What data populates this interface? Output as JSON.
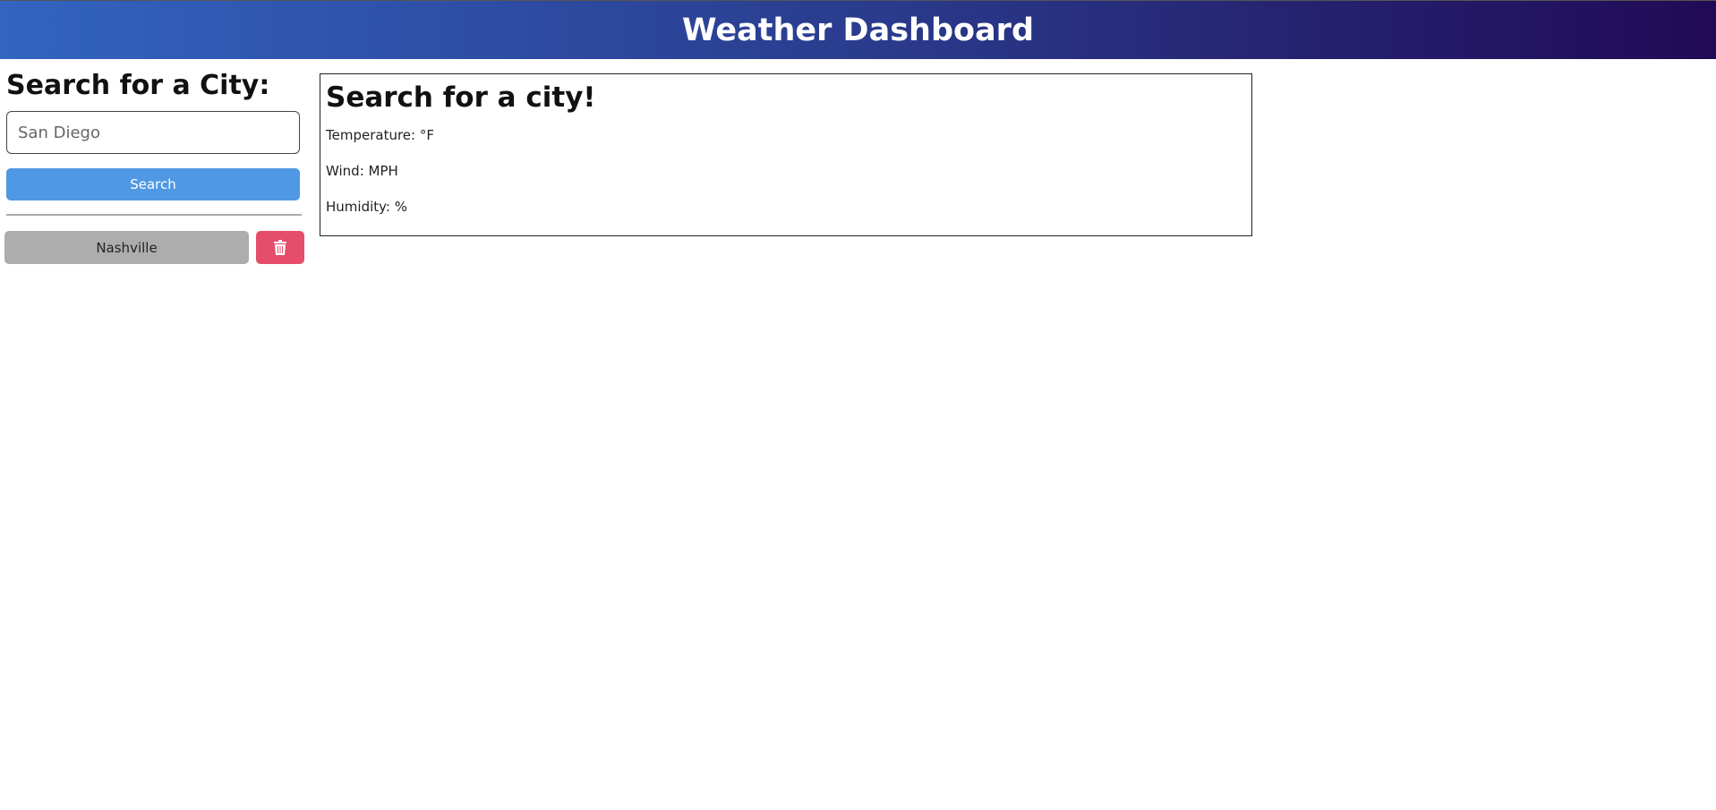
{
  "header": {
    "title": "Weather Dashboard"
  },
  "sidebar": {
    "title": "Search for a City:",
    "search_input_value": "San Diego",
    "search_label": "Search",
    "history": [
      {
        "label": "Nashville"
      }
    ],
    "delete_icon": "trash-icon"
  },
  "colors": {
    "search": "#4f98e3",
    "history": "#adadad",
    "delete": "#e64d6a"
  },
  "current": {
    "title": "Search for a city!",
    "temperature": "Temperature: °F",
    "wind": "Wind: MPH",
    "humidity": "Humidity: %"
  }
}
